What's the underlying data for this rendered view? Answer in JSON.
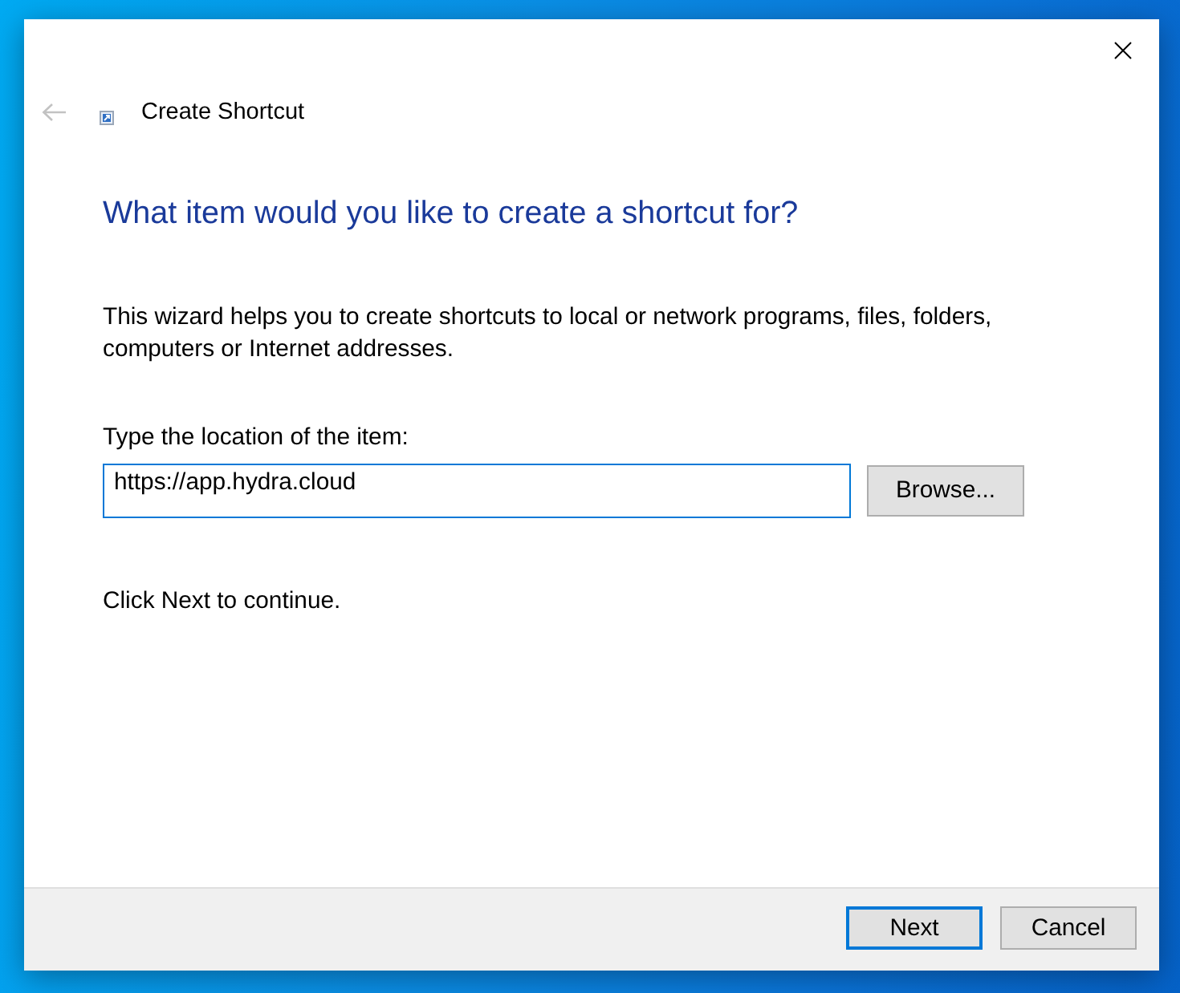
{
  "window": {
    "title": "Create Shortcut"
  },
  "back_button": {
    "disabled": true
  },
  "heading": "What item would you like to create a shortcut for?",
  "description": "This wizard helps you to create shortcuts to local or network programs, files, folders, computers or Internet addresses.",
  "location": {
    "label": "Type the location of the item:",
    "value": "https://app.hydra.cloud",
    "focused": true
  },
  "browse_button": "Browse...",
  "hint": "Click Next to continue.",
  "buttons": [
    {
      "label": "Next",
      "default": true
    },
    {
      "label": "Cancel",
      "default": false
    }
  ]
}
